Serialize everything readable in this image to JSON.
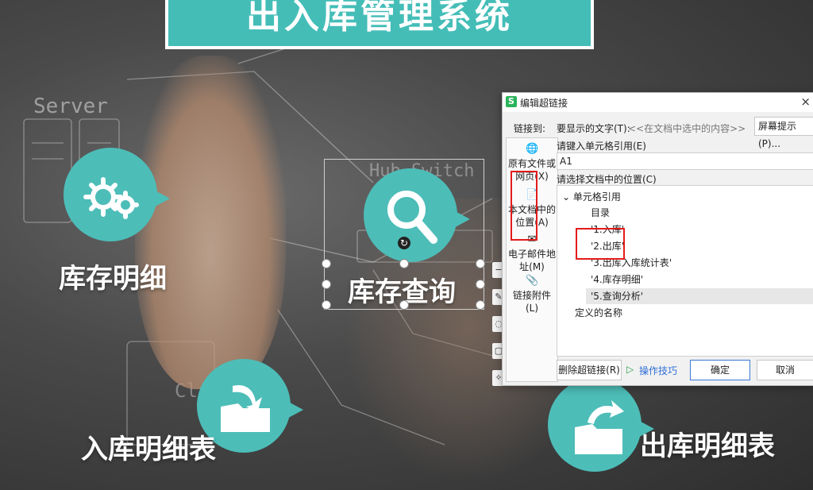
{
  "slide": {
    "title": "出入库管理系统",
    "bubbles": [
      {
        "label": "库存明细",
        "icon": "gears-icon"
      },
      {
        "label": "库存查询",
        "icon": "magnifier-icon"
      },
      {
        "label": "入库明细表",
        "icon": "folder-in-icon"
      },
      {
        "label": "出库明细表",
        "icon": "folder-out-icon"
      }
    ],
    "background_sketch_texts": [
      "Server",
      "Hub Switch",
      "Cli"
    ],
    "accent_color": "#4dbdb8"
  },
  "dialog": {
    "title": "编辑超链接",
    "app_logo": "S",
    "close_glyph": "×",
    "link_to_label": "链接到:",
    "display_text_label": "要显示的文字(T):",
    "display_text_value": "<<在文档中选中的内容>>",
    "screen_tip_button": "屏幕提示(P)...",
    "nav": [
      {
        "label": "原有文件或网页(X)",
        "icon": "web-page-icon"
      },
      {
        "label": "本文档中的位置(A)",
        "icon": "document-place-icon"
      },
      {
        "label": "电子邮件地址(M)",
        "icon": "email-icon"
      },
      {
        "label": "链接附件(L)",
        "icon": "paperclip-icon"
      }
    ],
    "cell_ref_caption": "请键入单元格引用(E)",
    "cell_ref_value": "A1",
    "place_caption": "请选择文档中的位置(C)",
    "tree": {
      "group": "单元格引用",
      "items": [
        "目录",
        "'1.入库'",
        "'2.出库'",
        "'3.出库入库统计表'",
        "'4.库存明细'",
        "'5.查询分析'"
      ],
      "selected_index": 5,
      "defined_names": "定义的名称"
    },
    "remove_link_button": "删除超链接(R)",
    "tips_link": "操作技巧",
    "ok_button": "确定",
    "cancel_button": "取消"
  }
}
